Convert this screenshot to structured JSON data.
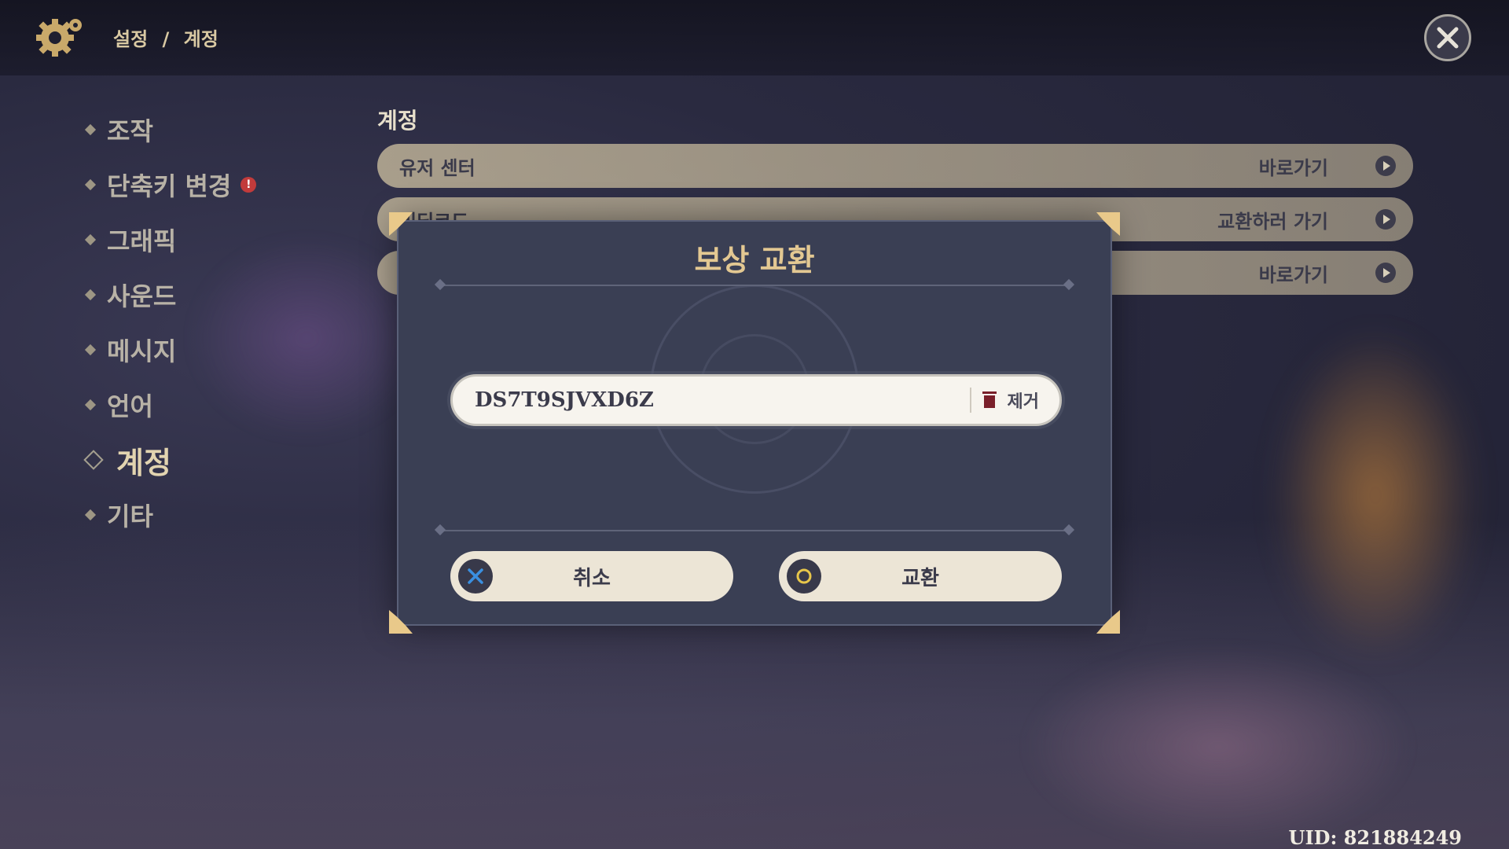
{
  "header": {
    "breadcrumb": [
      "설정",
      "/",
      "계정"
    ]
  },
  "sidebar": {
    "items": [
      {
        "label": "조작"
      },
      {
        "label": "단축키 변경",
        "badge": "!"
      },
      {
        "label": "그래픽"
      },
      {
        "label": "사운드"
      },
      {
        "label": "메시지"
      },
      {
        "label": "언어"
      },
      {
        "label": "계정",
        "active": true
      },
      {
        "label": "기타"
      }
    ]
  },
  "main": {
    "section_title": "계정",
    "rows": [
      {
        "label": "유저 센터",
        "action": "바로가기"
      },
      {
        "label": "리딤코드",
        "action": "교환하러 가기"
      },
      {
        "label": "",
        "action": "바로가기"
      }
    ]
  },
  "modal": {
    "title": "보상 교환",
    "code_value": "DS7T9SJVXD6Z",
    "clear_label": "제거",
    "cancel_label": "취소",
    "confirm_label": "교환"
  },
  "footer": {
    "uid": "UID: 821884249"
  },
  "colors": {
    "accent_gold": "#e3c892",
    "row_bg": "#d6c8a5",
    "modal_bg": "#3a3f54",
    "button_bg": "#ece5d6",
    "cancel_icon": "#3a8fe0",
    "confirm_icon": "#e7c64a"
  },
  "icons": {
    "settings": "gear-icon",
    "close": "close-icon",
    "go": "arrow-right-circle-icon",
    "trash": "trash-icon",
    "cancel": "x-button-icon",
    "confirm": "circle-button-icon"
  }
}
